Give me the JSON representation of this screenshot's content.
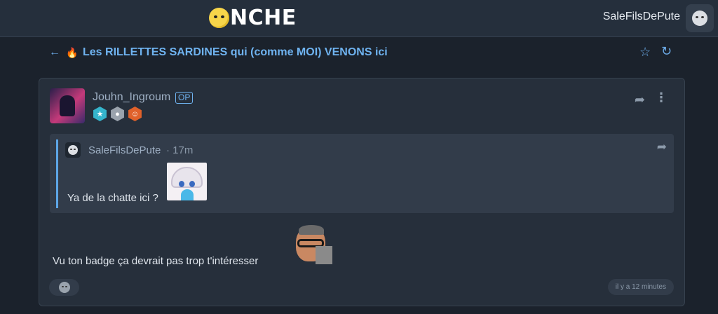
{
  "header": {
    "logo_text": "NCHE",
    "username": "SaleFilsDePute"
  },
  "topic": {
    "title": "Les RILLETTES SARDINES qui (comme MOI) VENONS ici"
  },
  "post": {
    "author": "Jouhn_Ingroum",
    "op_label": "OP",
    "badges": [
      "star-badge",
      "photo-badge",
      "face-badge"
    ],
    "quote": {
      "author": "SaleFilsDePute",
      "time": "· 17m",
      "text": "Ya de la chatte ici ?"
    },
    "text": "Vu ton badge ça devrait pas trop t'intéresser",
    "timestamp": "il y a 12 minutes"
  },
  "colors": {
    "accent": "#6fb3f0",
    "background": "#1b222c",
    "panel": "#262f3b"
  },
  "icons": {
    "back": "arrow-left-icon",
    "hot": "fire-icon",
    "favorite": "star-icon",
    "refresh": "refresh-icon",
    "share": "share-icon",
    "more": "more-vertical-icon"
  }
}
